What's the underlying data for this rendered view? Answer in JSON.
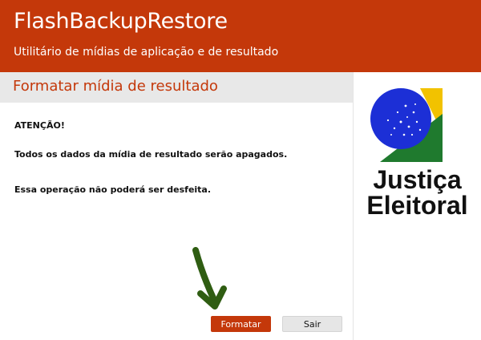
{
  "header": {
    "title": "FlashBackupRestore",
    "subtitle": "Utilitário de mídias de aplicação e de resultado"
  },
  "section": {
    "title": "Formatar mídia de resultado"
  },
  "messages": {
    "attention": "ATENÇÃO!",
    "warning": "Todos os dados da mídia de resultado serão apagados.",
    "irreversible": "Essa operação não poderá ser desfeita."
  },
  "buttons": {
    "format_label": "Formatar",
    "exit_label": "Sair"
  },
  "logo": {
    "line1": "Justiça",
    "line2": "Eleitoral"
  },
  "colors": {
    "accent": "#c4380a",
    "logo_green": "#1f7a2e",
    "logo_yellow": "#f2c200",
    "logo_blue": "#1c2fd6",
    "arrow_green": "#2f5d12"
  }
}
